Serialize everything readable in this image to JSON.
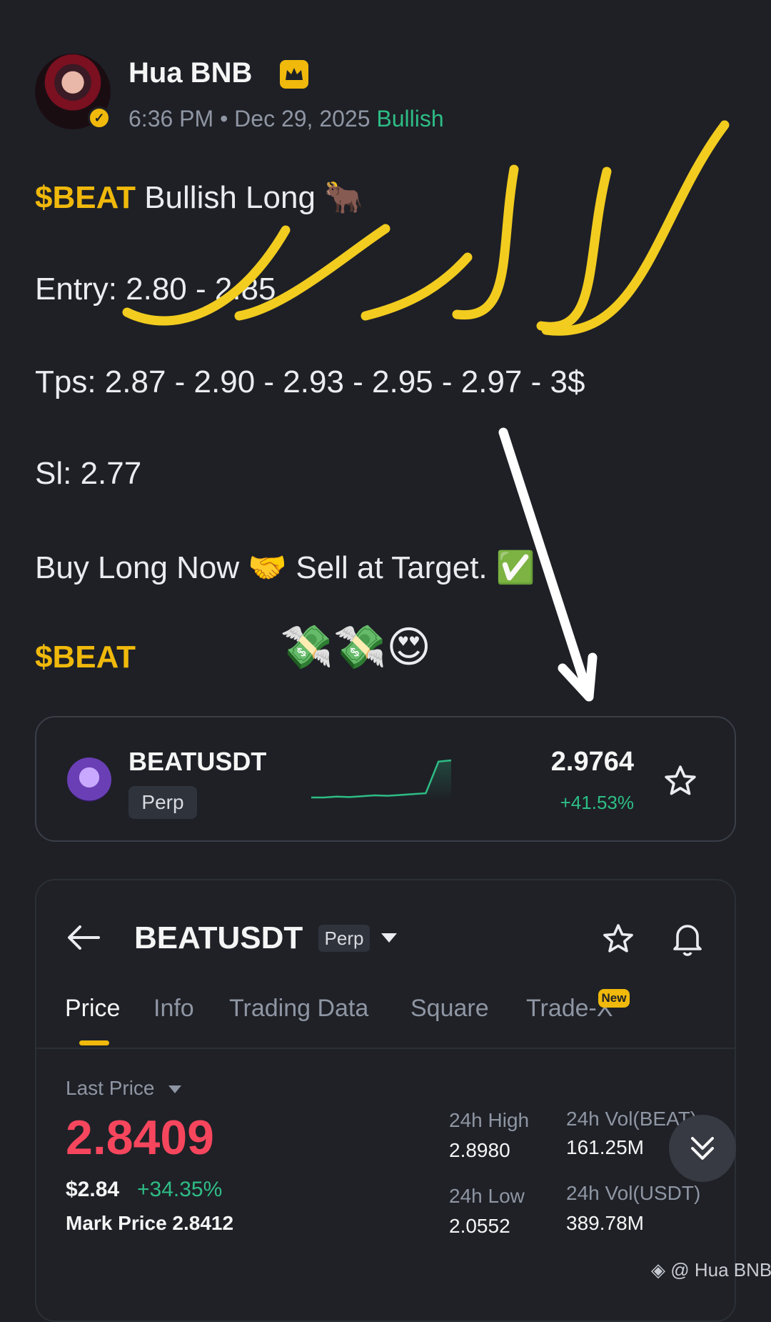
{
  "post": {
    "author": "Hua BNB",
    "time": "6:36 PM",
    "separator": "•",
    "date": "Dec 29, 2025",
    "sentiment": "Bullish",
    "lines": {
      "title_tag": "$BEAT",
      "title_text": " Bullish Long ",
      "title_emoji": "🐂",
      "entry": "Entry: 2.80 - 2.85",
      "tps": "Tps: 2.87 - 2.90 - 2.93 - 2.95 - 2.97 - 3$",
      "sl": "Sl: 2.77",
      "buy_a": "Buy Long Now ",
      "buy_emoji1": "🤝",
      "buy_b": " Sell at Target. ",
      "buy_emoji2": "✅",
      "footer_tag": "$BEAT",
      "footer_emojis": "💸💸😍"
    }
  },
  "ticker_card": {
    "symbol": "BEATUSDT",
    "type": "Perp",
    "price": "2.9764",
    "change": "+41.53%",
    "sparkline": [
      2.1,
      2.1,
      2.12,
      2.11,
      2.13,
      2.15,
      2.14,
      2.16,
      2.18,
      2.2,
      2.95,
      2.98
    ],
    "icon": "star-icon"
  },
  "market_panel": {
    "symbol": "BEATUSDT",
    "type": "Perp",
    "tabs": [
      "Price",
      "Info",
      "Trading Data",
      "Square",
      "Trade-X"
    ],
    "active_tab": "Price",
    "new_badge": "New",
    "last_price_label": "Last Price",
    "last_price": "2.8409",
    "usd_price": "$2.84",
    "usd_change": "+34.35%",
    "mark_price": "Mark Price  2.8412",
    "stats": {
      "high_label": "24h High",
      "high": "2.8980",
      "low_label": "24h Low",
      "low": "2.0552",
      "vol_beat_label": "24h Vol(BEAT)",
      "vol_beat": "161.25M",
      "vol_usdt_label": "24h Vol(USDT)",
      "vol_usdt": "389.78M"
    }
  },
  "watermark": "@ Hua BNB",
  "colors": {
    "background": "#1e2026",
    "brand_yellow": "#f0b90b",
    "up_green": "#2ebd85",
    "down_red": "#f6465d"
  }
}
